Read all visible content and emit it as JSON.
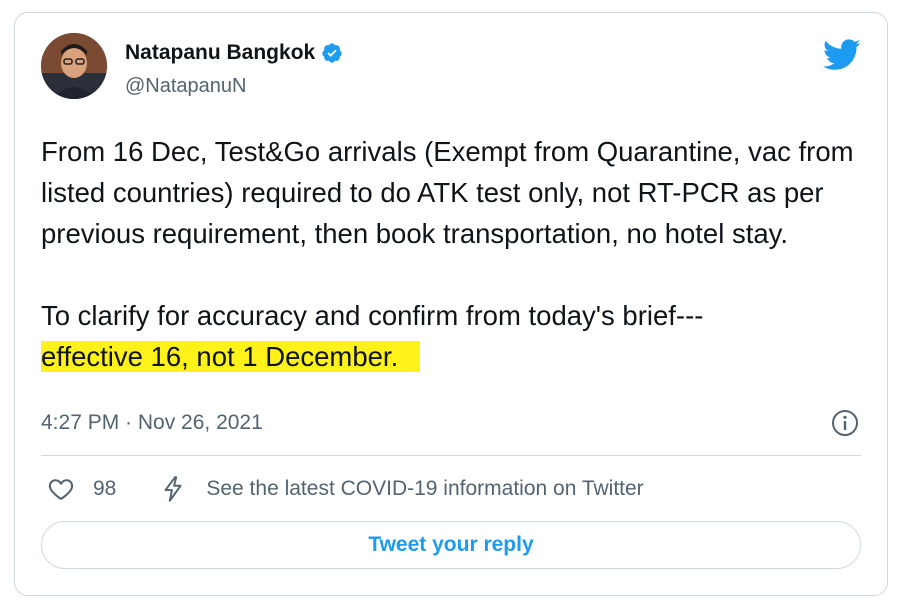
{
  "author": {
    "name": "Natapanu Bangkok",
    "handle": "@NatapanuN",
    "verified": true,
    "avatar_icon": "profile-photo"
  },
  "tweet": {
    "paragraph1": "From 16 Dec, Test&Go arrivals (Exempt from Quarantine, vac from listed countries) required to do ATK test only, not RT-PCR as per previous requirement, then book transportation, no hotel stay.",
    "paragraph2_lead": "To clarify for accuracy and confirm from today's brief---",
    "paragraph2_highlight": "effective 16, not 1 December."
  },
  "meta": {
    "timestamp": "4:27 PM · Nov 26, 2021"
  },
  "actions": {
    "like_count": "98",
    "covid_link": "See the latest COVID-19 information on Twitter"
  },
  "reply_button": "Tweet your reply",
  "colors": {
    "accent": "#1d9bf0",
    "highlight": "#fff21a",
    "text": "#0f1419",
    "muted": "#536471"
  },
  "icons": [
    "twitter-bird-icon",
    "verified-badge-icon",
    "info-icon",
    "heart-icon",
    "lightning-icon"
  ]
}
